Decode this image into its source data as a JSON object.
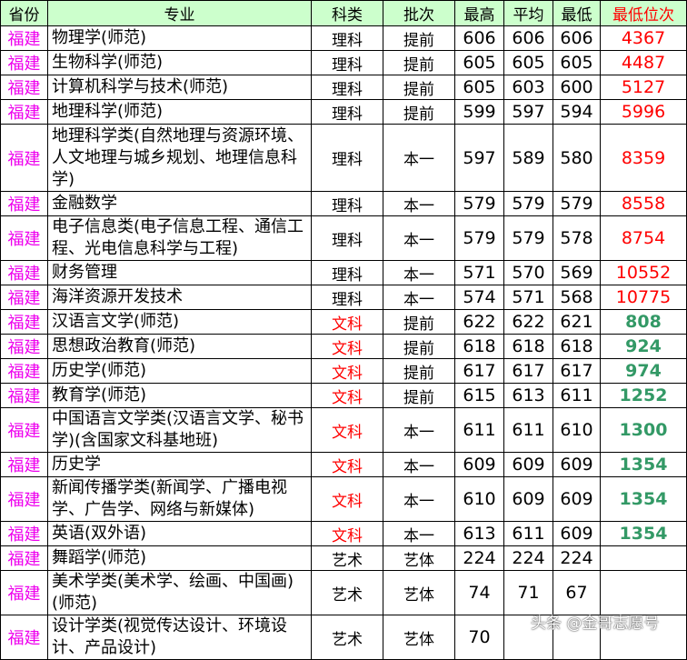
{
  "headers": {
    "province": "省份",
    "major": "专业",
    "subject": "科类",
    "batch": "批次",
    "max": "最高",
    "avg": "平均",
    "min": "最低",
    "min_rank": "最低位次"
  },
  "rows": [
    {
      "province": "福建",
      "major": "物理学(师范)",
      "subject": "理科",
      "batch": "提前",
      "max": "606",
      "avg": "606",
      "min": "606",
      "rank": "4367"
    },
    {
      "province": "福建",
      "major": "生物科学(师范)",
      "subject": "理科",
      "batch": "提前",
      "max": "605",
      "avg": "605",
      "min": "605",
      "rank": "4487"
    },
    {
      "province": "福建",
      "major": "计算机科学与技术(师范)",
      "subject": "理科",
      "batch": "提前",
      "max": "605",
      "avg": "603",
      "min": "600",
      "rank": "5127"
    },
    {
      "province": "福建",
      "major": "地理科学(师范)",
      "subject": "理科",
      "batch": "提前",
      "max": "599",
      "avg": "597",
      "min": "594",
      "rank": "5996"
    },
    {
      "province": "福建",
      "major": "地理科学类(自然地理与资源环境、人文地理与城乡规划、地理信息科学)",
      "subject": "理科",
      "batch": "本一",
      "max": "597",
      "avg": "589",
      "min": "580",
      "rank": "8359"
    },
    {
      "province": "福建",
      "major": "金融数学",
      "subject": "理科",
      "batch": "本一",
      "max": "579",
      "avg": "579",
      "min": "579",
      "rank": "8558"
    },
    {
      "province": "福建",
      "major": "电子信息类(电子信息工程、通信工程、光电信息科学与工程)",
      "subject": "理科",
      "batch": "本一",
      "max": "579",
      "avg": "579",
      "min": "578",
      "rank": "8754"
    },
    {
      "province": "福建",
      "major": "财务管理",
      "subject": "理科",
      "batch": "本一",
      "max": "571",
      "avg": "570",
      "min": "569",
      "rank": "10552"
    },
    {
      "province": "福建",
      "major": "海洋资源开发技术",
      "subject": "理科",
      "batch": "本一",
      "max": "574",
      "avg": "571",
      "min": "568",
      "rank": "10775"
    },
    {
      "province": "福建",
      "major": "汉语言文学(师范)",
      "subject": "文科",
      "batch": "提前",
      "max": "622",
      "avg": "622",
      "min": "621",
      "rank": "808"
    },
    {
      "province": "福建",
      "major": "思想政治教育(师范)",
      "subject": "文科",
      "batch": "提前",
      "max": "618",
      "avg": "618",
      "min": "618",
      "rank": "924"
    },
    {
      "province": "福建",
      "major": "历史学(师范)",
      "subject": "文科",
      "batch": "提前",
      "max": "617",
      "avg": "617",
      "min": "617",
      "rank": "974"
    },
    {
      "province": "福建",
      "major": "教育学(师范)",
      "subject": "文科",
      "batch": "提前",
      "max": "615",
      "avg": "613",
      "min": "611",
      "rank": "1252"
    },
    {
      "province": "福建",
      "major": "中国语言文学类(汉语言文学、秘书学)(含国家文科基地班)",
      "subject": "文科",
      "batch": "本一",
      "max": "611",
      "avg": "611",
      "min": "610",
      "rank": "1300"
    },
    {
      "province": "福建",
      "major": "历史学",
      "subject": "文科",
      "batch": "本一",
      "max": "609",
      "avg": "609",
      "min": "609",
      "rank": "1354"
    },
    {
      "province": "福建",
      "major": "新闻传播学类(新闻学、广播电视学、广告学、网络与新媒体)",
      "subject": "文科",
      "batch": "本一",
      "max": "610",
      "avg": "609",
      "min": "609",
      "rank": "1354"
    },
    {
      "province": "福建",
      "major": "英语(双外语)",
      "subject": "文科",
      "batch": "本一",
      "max": "613",
      "avg": "611",
      "min": "609",
      "rank": "1354"
    },
    {
      "province": "福建",
      "major": "舞蹈学(师范)",
      "subject": "艺术",
      "batch": "艺体",
      "max": "224",
      "avg": "224",
      "min": "224",
      "rank": ""
    },
    {
      "province": "福建",
      "major": "美术学类(美术学、绘画、中国画)(师范)",
      "subject": "艺术",
      "batch": "艺体",
      "max": "74",
      "avg": "71",
      "min": "67",
      "rank": ""
    },
    {
      "province": "福建",
      "major": "设计学类(视觉传达设计、环境设计、产品设计)",
      "subject": "艺术",
      "batch": "艺体",
      "max": "70",
      "avg": "",
      "min": "",
      "rank": ""
    }
  ],
  "colors": {
    "header_bg": "#ccffcc",
    "province": "#ee00ee",
    "science_rank": "#ff0000",
    "liberal_subject": "#ff0000",
    "liberal_rank": "#339966"
  },
  "watermark": "头条 @金哥志愿号"
}
